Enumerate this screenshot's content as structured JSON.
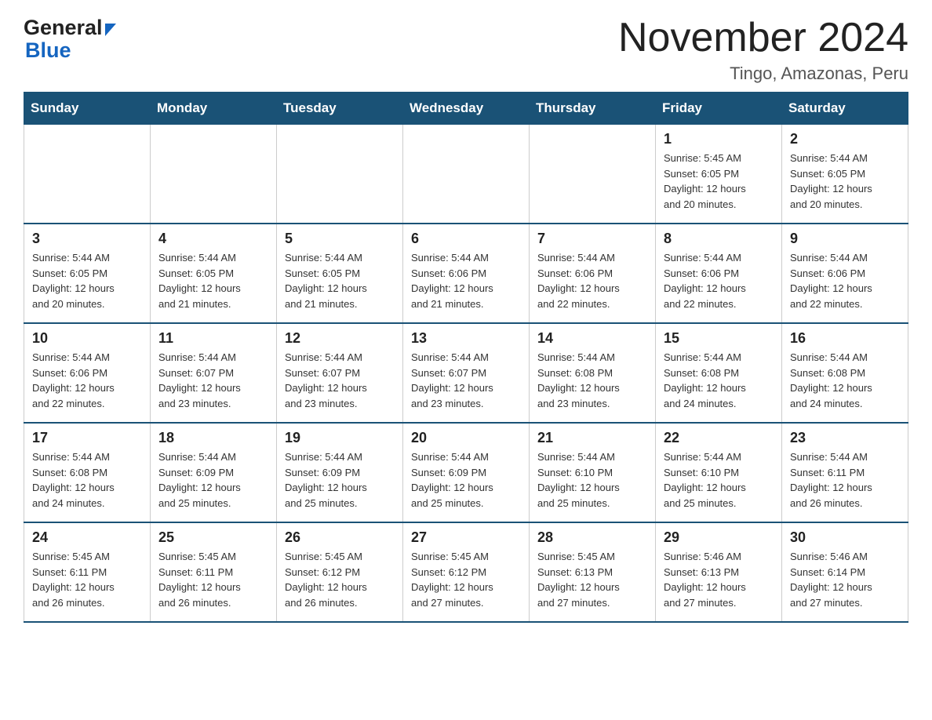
{
  "header": {
    "logo_general": "General",
    "logo_blue": "Blue",
    "month_title": "November 2024",
    "location": "Tingo, Amazonas, Peru"
  },
  "days_of_week": [
    "Sunday",
    "Monday",
    "Tuesday",
    "Wednesday",
    "Thursday",
    "Friday",
    "Saturday"
  ],
  "weeks": [
    [
      {
        "day": "",
        "info": ""
      },
      {
        "day": "",
        "info": ""
      },
      {
        "day": "",
        "info": ""
      },
      {
        "day": "",
        "info": ""
      },
      {
        "day": "",
        "info": ""
      },
      {
        "day": "1",
        "info": "Sunrise: 5:45 AM\nSunset: 6:05 PM\nDaylight: 12 hours\nand 20 minutes."
      },
      {
        "day": "2",
        "info": "Sunrise: 5:44 AM\nSunset: 6:05 PM\nDaylight: 12 hours\nand 20 minutes."
      }
    ],
    [
      {
        "day": "3",
        "info": "Sunrise: 5:44 AM\nSunset: 6:05 PM\nDaylight: 12 hours\nand 20 minutes."
      },
      {
        "day": "4",
        "info": "Sunrise: 5:44 AM\nSunset: 6:05 PM\nDaylight: 12 hours\nand 21 minutes."
      },
      {
        "day": "5",
        "info": "Sunrise: 5:44 AM\nSunset: 6:05 PM\nDaylight: 12 hours\nand 21 minutes."
      },
      {
        "day": "6",
        "info": "Sunrise: 5:44 AM\nSunset: 6:06 PM\nDaylight: 12 hours\nand 21 minutes."
      },
      {
        "day": "7",
        "info": "Sunrise: 5:44 AM\nSunset: 6:06 PM\nDaylight: 12 hours\nand 22 minutes."
      },
      {
        "day": "8",
        "info": "Sunrise: 5:44 AM\nSunset: 6:06 PM\nDaylight: 12 hours\nand 22 minutes."
      },
      {
        "day": "9",
        "info": "Sunrise: 5:44 AM\nSunset: 6:06 PM\nDaylight: 12 hours\nand 22 minutes."
      }
    ],
    [
      {
        "day": "10",
        "info": "Sunrise: 5:44 AM\nSunset: 6:06 PM\nDaylight: 12 hours\nand 22 minutes."
      },
      {
        "day": "11",
        "info": "Sunrise: 5:44 AM\nSunset: 6:07 PM\nDaylight: 12 hours\nand 23 minutes."
      },
      {
        "day": "12",
        "info": "Sunrise: 5:44 AM\nSunset: 6:07 PM\nDaylight: 12 hours\nand 23 minutes."
      },
      {
        "day": "13",
        "info": "Sunrise: 5:44 AM\nSunset: 6:07 PM\nDaylight: 12 hours\nand 23 minutes."
      },
      {
        "day": "14",
        "info": "Sunrise: 5:44 AM\nSunset: 6:08 PM\nDaylight: 12 hours\nand 23 minutes."
      },
      {
        "day": "15",
        "info": "Sunrise: 5:44 AM\nSunset: 6:08 PM\nDaylight: 12 hours\nand 24 minutes."
      },
      {
        "day": "16",
        "info": "Sunrise: 5:44 AM\nSunset: 6:08 PM\nDaylight: 12 hours\nand 24 minutes."
      }
    ],
    [
      {
        "day": "17",
        "info": "Sunrise: 5:44 AM\nSunset: 6:08 PM\nDaylight: 12 hours\nand 24 minutes."
      },
      {
        "day": "18",
        "info": "Sunrise: 5:44 AM\nSunset: 6:09 PM\nDaylight: 12 hours\nand 25 minutes."
      },
      {
        "day": "19",
        "info": "Sunrise: 5:44 AM\nSunset: 6:09 PM\nDaylight: 12 hours\nand 25 minutes."
      },
      {
        "day": "20",
        "info": "Sunrise: 5:44 AM\nSunset: 6:09 PM\nDaylight: 12 hours\nand 25 minutes."
      },
      {
        "day": "21",
        "info": "Sunrise: 5:44 AM\nSunset: 6:10 PM\nDaylight: 12 hours\nand 25 minutes."
      },
      {
        "day": "22",
        "info": "Sunrise: 5:44 AM\nSunset: 6:10 PM\nDaylight: 12 hours\nand 25 minutes."
      },
      {
        "day": "23",
        "info": "Sunrise: 5:44 AM\nSunset: 6:11 PM\nDaylight: 12 hours\nand 26 minutes."
      }
    ],
    [
      {
        "day": "24",
        "info": "Sunrise: 5:45 AM\nSunset: 6:11 PM\nDaylight: 12 hours\nand 26 minutes."
      },
      {
        "day": "25",
        "info": "Sunrise: 5:45 AM\nSunset: 6:11 PM\nDaylight: 12 hours\nand 26 minutes."
      },
      {
        "day": "26",
        "info": "Sunrise: 5:45 AM\nSunset: 6:12 PM\nDaylight: 12 hours\nand 26 minutes."
      },
      {
        "day": "27",
        "info": "Sunrise: 5:45 AM\nSunset: 6:12 PM\nDaylight: 12 hours\nand 27 minutes."
      },
      {
        "day": "28",
        "info": "Sunrise: 5:45 AM\nSunset: 6:13 PM\nDaylight: 12 hours\nand 27 minutes."
      },
      {
        "day": "29",
        "info": "Sunrise: 5:46 AM\nSunset: 6:13 PM\nDaylight: 12 hours\nand 27 minutes."
      },
      {
        "day": "30",
        "info": "Sunrise: 5:46 AM\nSunset: 6:14 PM\nDaylight: 12 hours\nand 27 minutes."
      }
    ]
  ]
}
